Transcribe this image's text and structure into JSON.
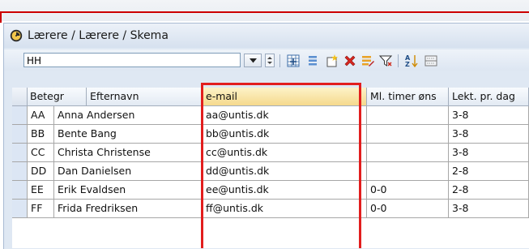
{
  "window": {
    "title": "Lærere / Lærere / Skema"
  },
  "toolbar": {
    "filter_value": "HH",
    "icons": [
      "clock-icon",
      "dropdown-icon",
      "spin-icon",
      "table-new-icon",
      "list-icon",
      "new-record-icon",
      "delete-icon",
      "edit-icon",
      "filter-icon",
      "sort-icon",
      "field-icon"
    ]
  },
  "table": {
    "columns": [
      "Betegr",
      "Efternavn",
      "e-mail",
      "Ml. timer øns",
      "Lekt. pr. dag"
    ],
    "rows": [
      [
        "AA",
        "Anna Andersen",
        "aa@untis.dk",
        "",
        "3-8"
      ],
      [
        "BB",
        "Bente Bang",
        "bb@untis.dk",
        "",
        "3-8"
      ],
      [
        "CC",
        "Christa Christense",
        "cc@untis.dk",
        "",
        "3-8"
      ],
      [
        "DD",
        "Dan Danielsen",
        "dd@untis.dk",
        "",
        "2-8"
      ],
      [
        "EE",
        "Erik Evaldsen",
        "ee@untis.dk",
        "0-0",
        "2-8"
      ],
      [
        "FF",
        "Frida Fredriksen",
        "ff@untis.dk",
        "0-0",
        "3-8"
      ]
    ]
  },
  "colors": {
    "highlight": "#e21e1e",
    "header_active": "#f5d98d"
  }
}
